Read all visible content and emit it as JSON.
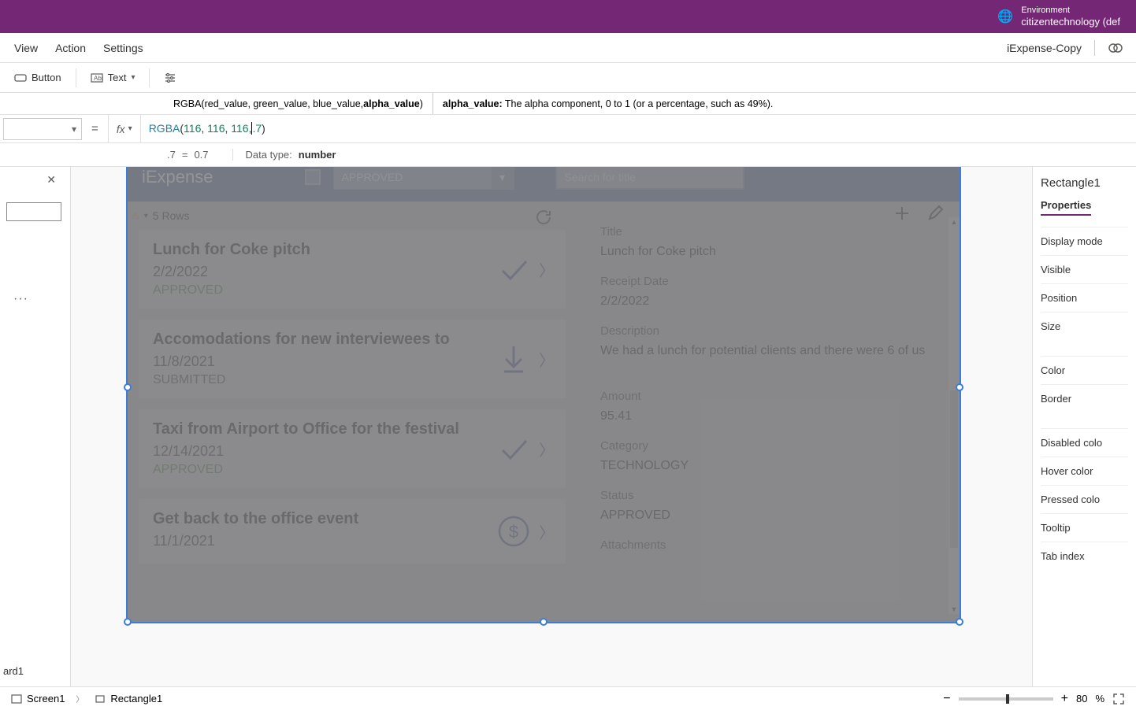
{
  "environment": {
    "label": "Environment",
    "name": "citizentechnology (def"
  },
  "menubar": {
    "view": "View",
    "action": "Action",
    "settings": "Settings",
    "filename": "iExpense-Copy"
  },
  "toolbar": {
    "button": "Button",
    "text": "Text"
  },
  "hint": {
    "signature_prefix": "RGBA(red_value, green_value, blue_value, ",
    "signature_bold": "alpha_value",
    "signature_suffix": ")",
    "param_name": "alpha_value:",
    "param_desc": " The alpha component, 0 to 1 (or a percentage, such as 49%)."
  },
  "formula": {
    "eq": "=",
    "fx": "fx",
    "fn": "RGBA",
    "open": "(",
    "a1": "116",
    "c1": ", ",
    "a2": "116",
    "c2": ", ",
    "a3": "116",
    "c3": ",",
    "a4": ".7",
    "close": ")"
  },
  "result": {
    "lhs": ".7",
    "eq": "=",
    "rhs": "0.7",
    "dtype_label": "Data type:",
    "dtype": "number"
  },
  "left": {
    "card": "ard1"
  },
  "app": {
    "title": "iExpense",
    "dropdown": "APPROVED",
    "search_placeholder": "Search for title",
    "rows_label": "5 Rows",
    "items": [
      {
        "title": "Lunch for Coke pitch",
        "date": "2/2/2022",
        "status": "APPROVED",
        "icon": "check"
      },
      {
        "title": "Accomodations for new interviewees to",
        "date": "11/8/2021",
        "status": "SUBMITTED",
        "icon": "download"
      },
      {
        "title": "Taxi from Airport to Office for the festival",
        "date": "12/14/2021",
        "status": "APPROVED",
        "icon": "check"
      },
      {
        "title": "Get back to the office event",
        "date": "11/1/2021",
        "status": "",
        "icon": "dollar"
      }
    ],
    "detail": {
      "title_label": "Title",
      "title_value": "Lunch for Coke pitch",
      "date_label": "Receipt Date",
      "date_value": "2/2/2022",
      "desc_label": "Description",
      "desc_value": "We had a lunch for potential clients and there were 6 of us",
      "amount_label": "Amount",
      "amount_value": "95.41",
      "category_label": "Category",
      "category_value": "TECHNOLOGY",
      "status_label": "Status",
      "status_value": "APPROVED",
      "attachments_label": "Attachments"
    }
  },
  "props": {
    "name": "Rectangle1",
    "tab": "Properties",
    "rows": [
      "Display mode",
      "Visible",
      "Position",
      "Size",
      "Color",
      "Border",
      "Disabled colo",
      "Hover color",
      "Pressed colo",
      "Tooltip",
      "Tab index"
    ]
  },
  "footer": {
    "screen": "Screen1",
    "rect": "Rectangle1",
    "zoom": "80",
    "pct": "%"
  }
}
